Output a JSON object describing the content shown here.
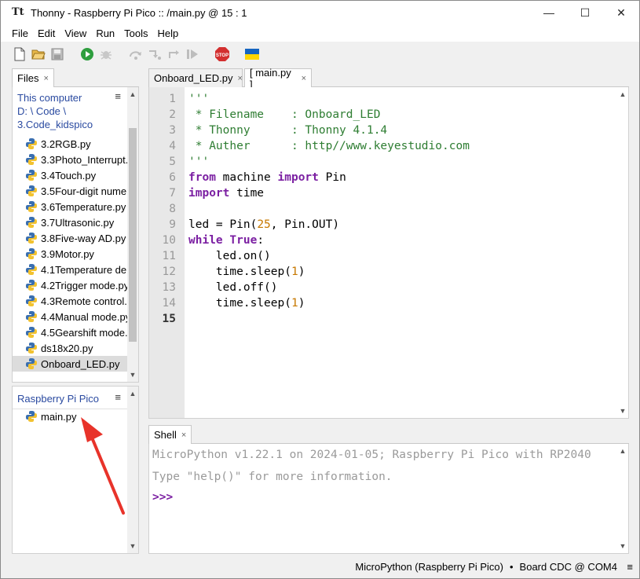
{
  "window": {
    "title": "Thonny  -  Raspberry Pi Pico :: /main.py  @  15 : 1",
    "controls": {
      "minimize": "—",
      "maximize": "☐",
      "close": "✕"
    }
  },
  "menu": [
    "File",
    "Edit",
    "View",
    "Run",
    "Tools",
    "Help"
  ],
  "toolbar": {
    "icons": [
      "new-file-icon",
      "open-file-icon",
      "save-icon",
      "run-icon",
      "debug-icon",
      "step-over-icon",
      "step-into-icon",
      "step-out-icon",
      "resume-icon",
      "stop-icon",
      "ukraine-flag-icon"
    ],
    "stop_label": "STOP"
  },
  "files": {
    "tab_label": "Files",
    "tab_close": "×",
    "menu_glyph": "≡",
    "this_computer": "This computer",
    "path1": "D: \\ Code \\",
    "path2": "3.Code_kidspico",
    "items": [
      "3.2RGB.py",
      "3.3Photo_Interrupt.",
      "3.4Touch.py",
      "3.5Four-digit  nume",
      "3.6Temperature.py",
      "3.7Ultrasonic.py",
      "3.8Five-way AD.py",
      "3.9Motor.py",
      "4.1Temperature de",
      "4.2Trigger mode.py",
      "4.3Remote control.",
      "4.4Manual mode.py",
      "4.5Gearshift mode.",
      "ds18x20.py",
      "Onboard_LED.py"
    ],
    "selected_index": 14
  },
  "device": {
    "title": "Raspberry Pi Pico",
    "menu_glyph": "≡",
    "items": [
      "main.py"
    ]
  },
  "editor": {
    "tabs": [
      {
        "label": "Onboard_LED.py",
        "close": "×",
        "active": false
      },
      {
        "label": "[ main.py ]",
        "close": "×",
        "active": true
      }
    ],
    "current_line": 15,
    "lines": [
      {
        "n": "1",
        "tokens": [
          [
            "str",
            "'''"
          ]
        ]
      },
      {
        "n": "2",
        "tokens": [
          [
            "str",
            " * Filename    : Onboard_LED"
          ]
        ]
      },
      {
        "n": "3",
        "tokens": [
          [
            "str",
            " * Thonny      : Thonny 4.1.4"
          ]
        ]
      },
      {
        "n": "4",
        "tokens": [
          [
            "str",
            " * Auther      : http//www.keyestudio.com"
          ]
        ]
      },
      {
        "n": "5",
        "tokens": [
          [
            "str",
            "'''"
          ]
        ]
      },
      {
        "n": "6",
        "tokens": [
          [
            "kw",
            "from"
          ],
          [
            "plain",
            " machine "
          ],
          [
            "kw",
            "import"
          ],
          [
            "plain",
            " Pin"
          ]
        ]
      },
      {
        "n": "7",
        "tokens": [
          [
            "kw",
            "import"
          ],
          [
            "plain",
            " time"
          ]
        ]
      },
      {
        "n": "8",
        "tokens": []
      },
      {
        "n": "9",
        "tokens": [
          [
            "plain",
            "led = Pin("
          ],
          [
            "num",
            "25"
          ],
          [
            "plain",
            ", Pin.OUT)"
          ]
        ]
      },
      {
        "n": "10",
        "tokens": [
          [
            "kw",
            "while"
          ],
          [
            "plain",
            " "
          ],
          [
            "kw",
            "True"
          ],
          [
            "plain",
            ":"
          ]
        ]
      },
      {
        "n": "11",
        "tokens": [
          [
            "plain",
            "    led.on()"
          ]
        ]
      },
      {
        "n": "12",
        "tokens": [
          [
            "plain",
            "    time.sleep("
          ],
          [
            "num",
            "1"
          ],
          [
            "plain",
            ")"
          ]
        ]
      },
      {
        "n": "13",
        "tokens": [
          [
            "plain",
            "    led.off()"
          ]
        ]
      },
      {
        "n": "14",
        "tokens": [
          [
            "plain",
            "    time.sleep("
          ],
          [
            "num",
            "1"
          ],
          [
            "plain",
            ")"
          ]
        ]
      },
      {
        "n": "15",
        "tokens": []
      }
    ]
  },
  "shell": {
    "tab_label": "Shell",
    "tab_close": "×",
    "banner": "MicroPython v1.22.1 on 2024-01-05; Raspberry Pi Pico with RP2040",
    "help_hint": "Type \"help()\" for more information.",
    "prompt": ">>>"
  },
  "status": {
    "interpreter": "MicroPython (Raspberry Pi Pico)",
    "separator": "•",
    "port": "Board CDC @ COM4",
    "menu_glyph": "≡"
  },
  "colors": {
    "string": "#2e7d32",
    "keyword": "#7b1fa2",
    "number": "#c77800",
    "path_link": "#2a4aa0",
    "prompt": "#7b1fa2",
    "annotation_arrow": "#e8332a"
  }
}
